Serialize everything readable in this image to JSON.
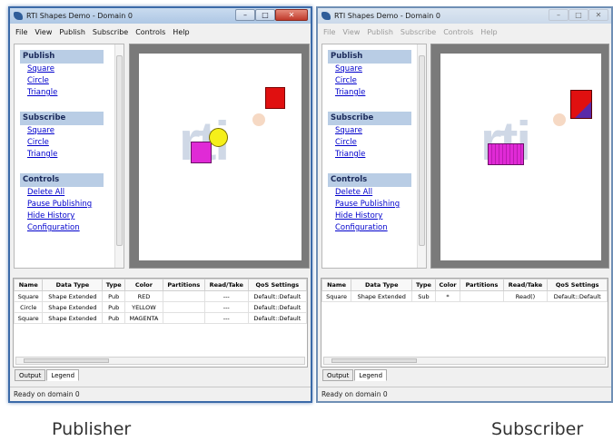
{
  "publisher": {
    "title": "RTI Shapes Demo - Domain 0",
    "controls": {
      "minimize": "–",
      "maximize": "□",
      "close": "✕"
    },
    "menu": [
      "File",
      "View",
      "Publish",
      "Subscribe",
      "Controls",
      "Help"
    ],
    "sections": {
      "publish": {
        "header": "Publish",
        "links": [
          "Square",
          "Circle",
          "Triangle"
        ]
      },
      "subscribe": {
        "header": "Subscribe",
        "links": [
          "Square",
          "Circle",
          "Triangle"
        ]
      },
      "controls": {
        "header": "Controls",
        "links": [
          "Delete All",
          "Pause Publishing",
          "Hide History",
          "Configuration"
        ]
      }
    },
    "watermark": "rti",
    "table": {
      "headers": [
        "Name",
        "Data Type",
        "Type",
        "Color",
        "Partitions",
        "Read/Take",
        "QoS Settings"
      ],
      "rows": [
        [
          "Square",
          "Shape Extended",
          "Pub",
          "RED",
          "",
          "---",
          "Default::Default"
        ],
        [
          "Circle",
          "Shape Extended",
          "Pub",
          "YELLOW",
          "",
          "---",
          "Default::Default"
        ],
        [
          "Square",
          "Shape Extended",
          "Pub",
          "MAGENTA",
          "",
          "---",
          "Default::Default"
        ]
      ]
    },
    "tabs": [
      "Output",
      "Legend"
    ],
    "status": "Ready on domain 0",
    "caption": "Publisher"
  },
  "subscriber": {
    "title": "RTI Shapes Demo - Domain 0",
    "controls": {
      "minimize": "–",
      "maximize": "□",
      "close": "✕"
    },
    "menu": [
      "File",
      "View",
      "Publish",
      "Subscribe",
      "Controls",
      "Help"
    ],
    "sections": {
      "publish": {
        "header": "Publish",
        "links": [
          "Square",
          "Circle",
          "Triangle"
        ]
      },
      "subscribe": {
        "header": "Subscribe",
        "links": [
          "Square",
          "Circle",
          "Triangle"
        ]
      },
      "controls": {
        "header": "Controls",
        "links": [
          "Delete All",
          "Pause Publishing",
          "Hide History",
          "Configuration"
        ]
      }
    },
    "watermark": "rti",
    "table": {
      "headers": [
        "Name",
        "Data Type",
        "Type",
        "Color",
        "Partitions",
        "Read/Take",
        "QoS Settings"
      ],
      "rows": [
        [
          "Square",
          "Shape Extended",
          "Sub",
          "*",
          "",
          "Read()",
          "Default::Default"
        ]
      ]
    },
    "tabs": [
      "Output",
      "Legend"
    ],
    "status": "Ready on domain 0",
    "caption": "Subscriber"
  },
  "colors": {
    "red": "#e01010",
    "yellow": "#f5ef1a",
    "magenta": "#e02ad6",
    "header_bg": "#b9cde5",
    "link": "#0000cc"
  }
}
